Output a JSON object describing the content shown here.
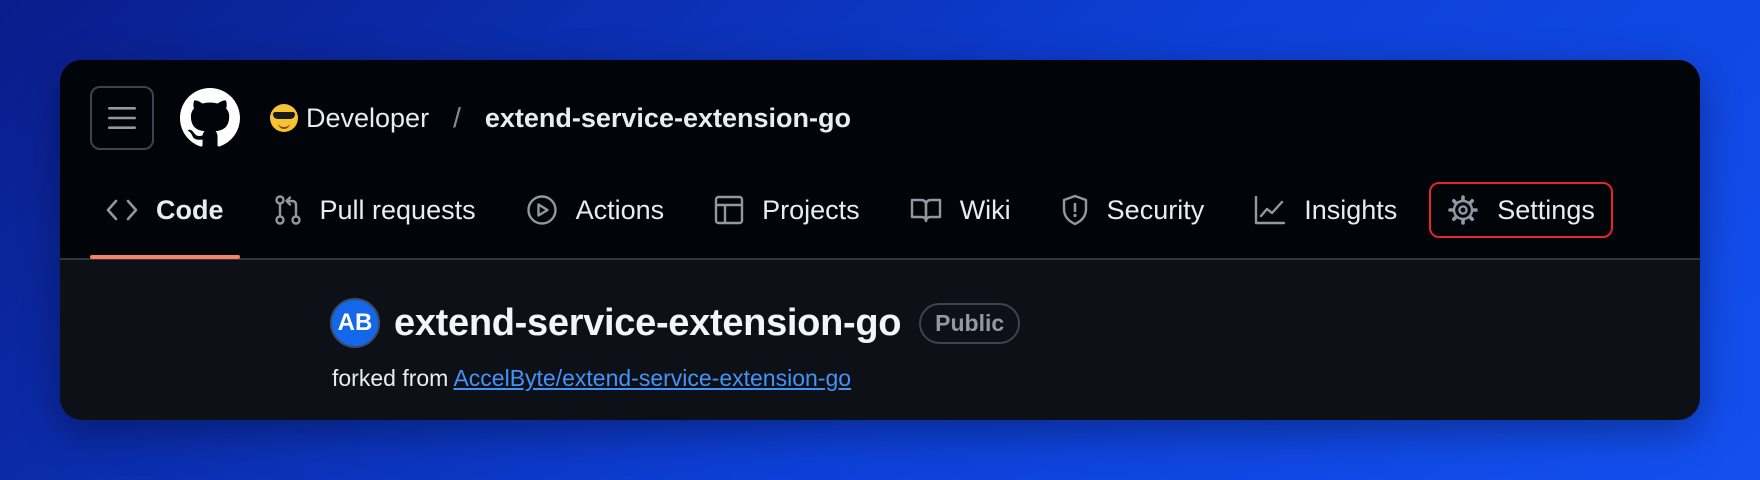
{
  "header": {
    "owner": "Developer",
    "separator": "/",
    "repo": "extend-service-extension-go",
    "owner_icon": "sunglasses-emoji-icon",
    "logo_icon": "github-logo-icon"
  },
  "nav": {
    "tabs": [
      {
        "label": "Code",
        "icon": "code-icon",
        "active": true
      },
      {
        "label": "Pull requests",
        "icon": "pull-request-icon"
      },
      {
        "label": "Actions",
        "icon": "play-icon"
      },
      {
        "label": "Projects",
        "icon": "table-icon"
      },
      {
        "label": "Wiki",
        "icon": "book-icon"
      },
      {
        "label": "Security",
        "icon": "shield-icon"
      },
      {
        "label": "Insights",
        "icon": "graph-icon"
      },
      {
        "label": "Settings",
        "icon": "gear-icon",
        "highlighted": true
      }
    ]
  },
  "repo": {
    "avatar_text": "AB",
    "title": "extend-service-extension-go",
    "visibility": "Public",
    "fork_prefix": "forked from",
    "fork_source": "AccelByte/extend-service-extension-go"
  },
  "colors": {
    "accent_underline": "#f78166",
    "highlight_outline": "#e5252a",
    "link": "#4493f8",
    "avatar_bg": "#1467e8"
  }
}
